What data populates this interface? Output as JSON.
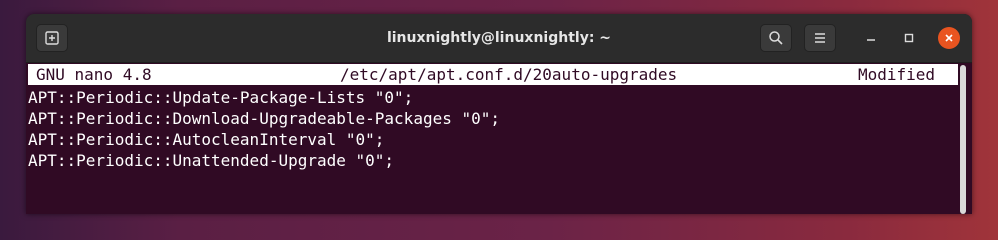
{
  "window": {
    "title": "linuxnightly@linuxnightly: ~"
  },
  "titlebar": {
    "new_tab_icon": "new-tab-icon",
    "search_icon": "search-icon",
    "menu_icon": "hamburger-menu-icon",
    "minimize_icon": "minimize-icon",
    "maximize_icon": "maximize-icon",
    "close_icon": "close-icon"
  },
  "nano": {
    "app": "GNU nano 4.8",
    "file": "/etc/apt/apt.conf.d/20auto-upgrades",
    "status": "Modified"
  },
  "lines": [
    "APT::Periodic::Update-Package-Lists \"0\";",
    "APT::Periodic::Download-Upgradeable-Packages \"0\";",
    "APT::Periodic::AutocleanInterval \"0\";",
    "APT::Periodic::Unattended-Upgrade \"0\";"
  ],
  "colors": {
    "terminal_bg": "#300a24",
    "titlebar_bg": "#2c2c2c",
    "close_button": "#e95420"
  }
}
